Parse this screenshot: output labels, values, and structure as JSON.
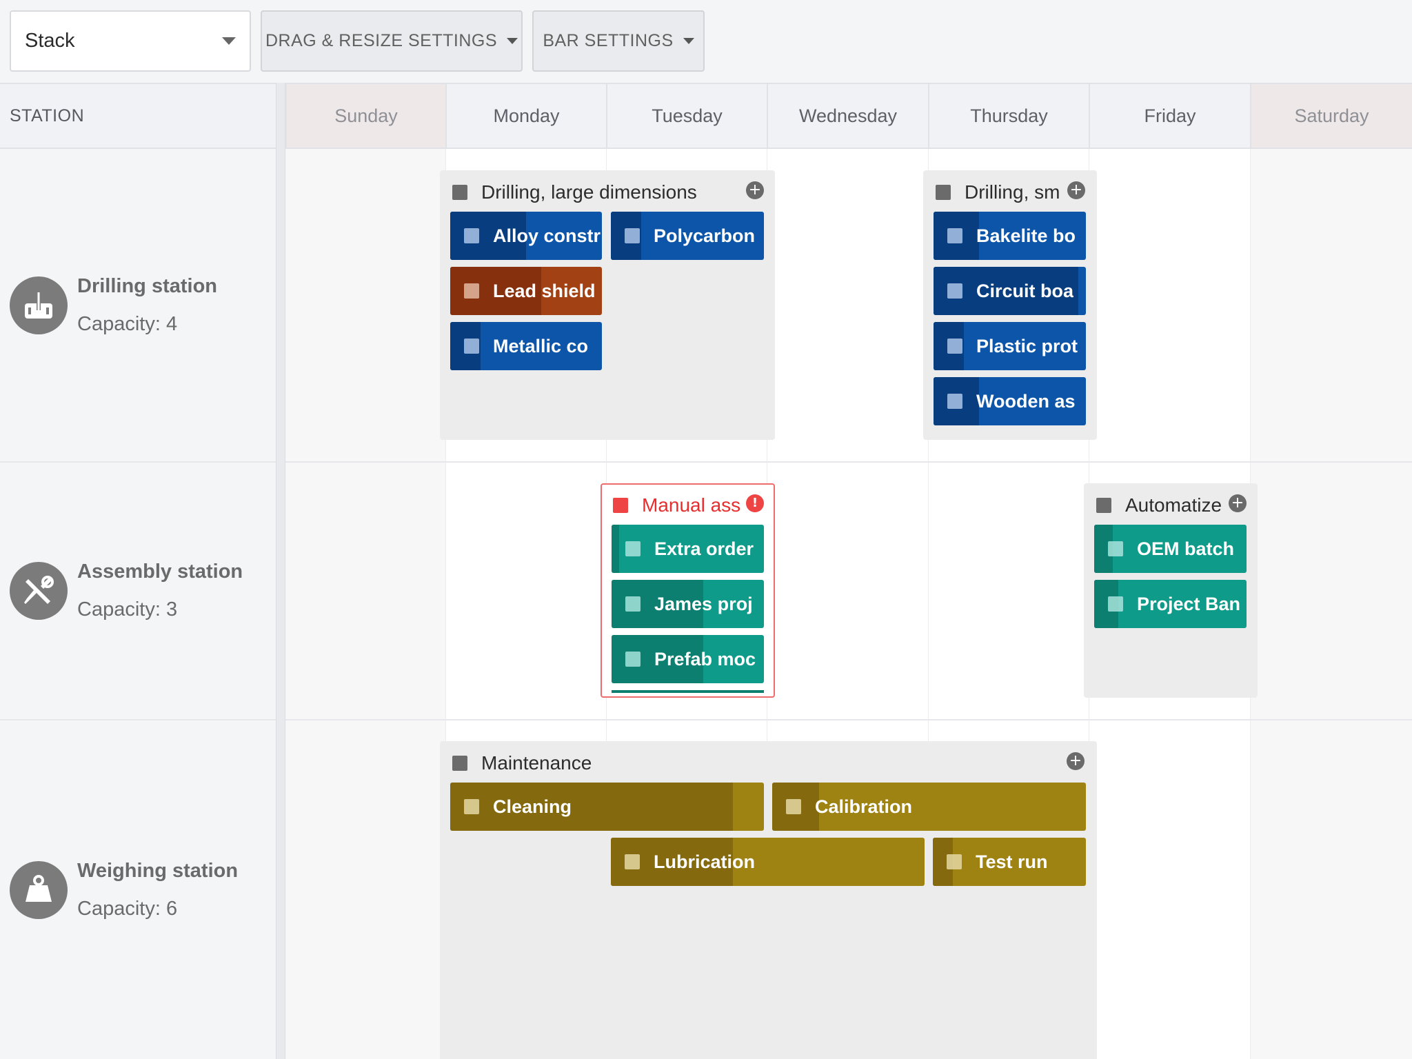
{
  "toolbar": {
    "mode_value": "Stack",
    "drag_resize_label": "DRAG & RESIZE SETTINGS",
    "bar_settings_label": "BAR SETTINGS"
  },
  "header": {
    "station_label": "STATION",
    "days": [
      "Sunday",
      "Monday",
      "Tuesday",
      "Wednesday",
      "Thursday",
      "Friday",
      "Saturday"
    ]
  },
  "resources": [
    {
      "name": "Drilling station",
      "capacity": "Capacity: 4",
      "icon": "drill-icon"
    },
    {
      "name": "Assembly station",
      "capacity": "Capacity: 3",
      "icon": "tools-icon"
    },
    {
      "name": "Weighing station",
      "capacity": "Capacity: 6",
      "icon": "weight-icon"
    }
  ],
  "groups": {
    "drill_large": {
      "title": "Drilling, large dimensions",
      "tasks": [
        "Alloy constr",
        "Polycarbon",
        "Lead shield",
        "Metallic co"
      ]
    },
    "drill_small": {
      "title": "Drilling, sm",
      "tasks": [
        "Bakelite bo",
        "Circuit boa",
        "Plastic prot",
        "Wooden as"
      ]
    },
    "manual": {
      "title": "Manual ass",
      "tasks": [
        "Extra order",
        "James proj",
        "Prefab moc"
      ]
    },
    "auto": {
      "title": "Automatize",
      "tasks": [
        "OEM batch",
        "Project Ban"
      ]
    },
    "maintenance": {
      "title": "Maintenance",
      "tasks": [
        "Cleaning",
        "Calibration",
        "Lubrication",
        "Test run"
      ]
    }
  },
  "progress": {
    "drill_large": [
      0.5,
      0.2,
      0.6,
      0.2
    ],
    "drill_small": [
      0.3,
      0.95,
      0.2,
      0.3
    ],
    "manual": [
      0.05,
      0.6,
      0.6
    ],
    "auto": [
      0.12,
      0.16
    ],
    "maintenance": [
      0.9,
      0.15,
      0.39,
      0.13
    ]
  },
  "colors": {
    "blue": "#0c55a8",
    "orange": "#a14114",
    "teal": "#0f9b8a",
    "olive": "#9e8212",
    "alert": "#ef4444"
  }
}
